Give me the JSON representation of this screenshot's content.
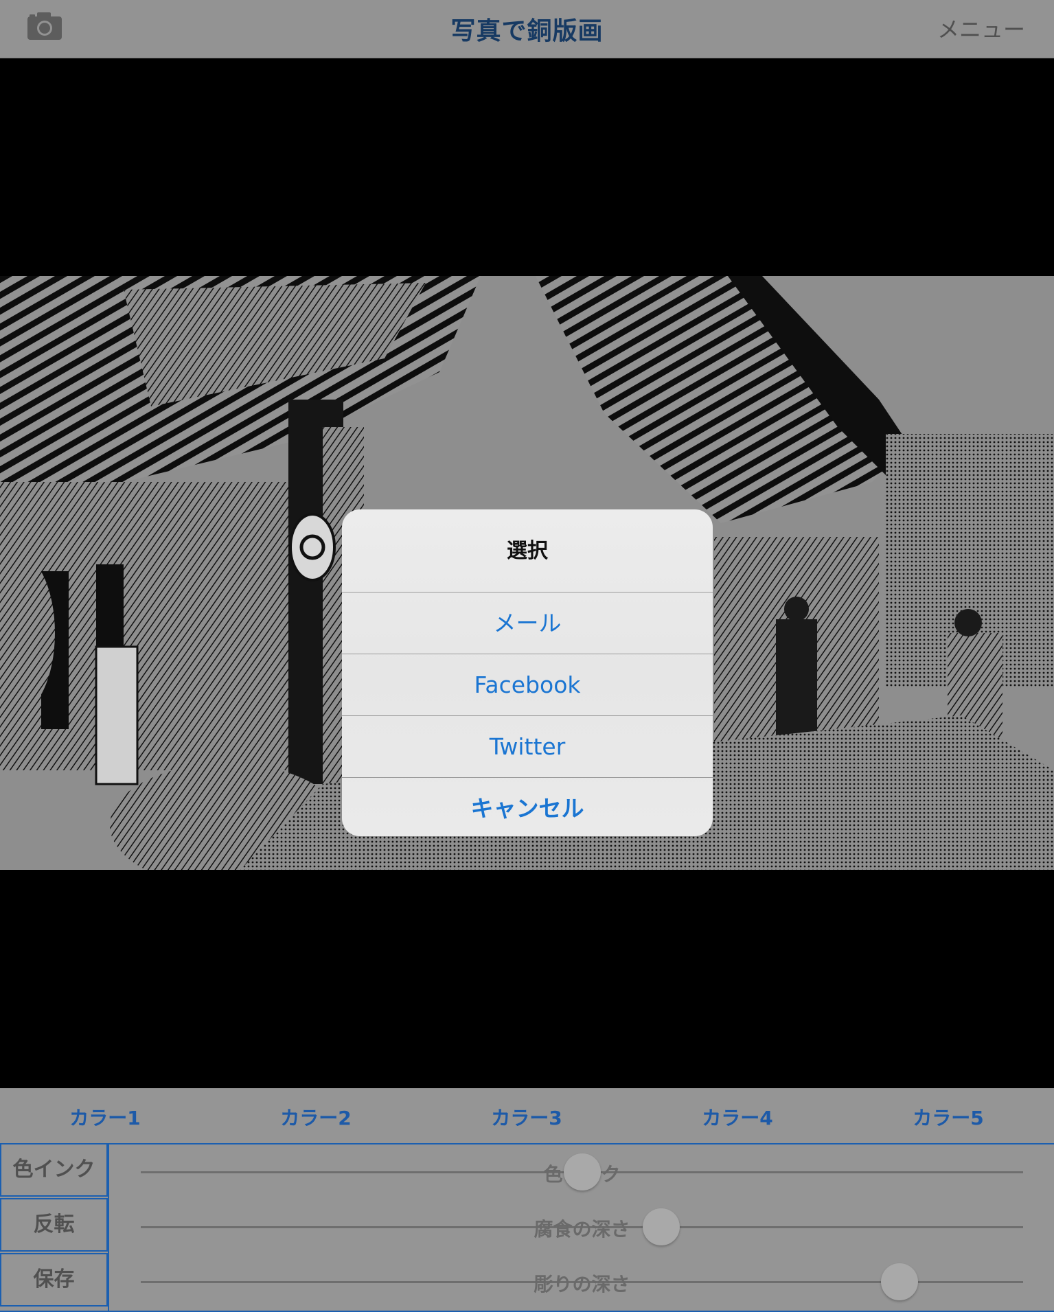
{
  "app": {
    "title": "写真で銅版画",
    "menu_label": "メニュー",
    "camera_icon": "camera-icon"
  },
  "dialog": {
    "title": "選択",
    "options": [
      "メール",
      "Facebook",
      "Twitter"
    ],
    "cancel_label": "キャンセル"
  },
  "panel": {
    "color_tabs": [
      "カラー1",
      "カラー2",
      "カラー3",
      "カラー4",
      "カラー5"
    ],
    "buttons": {
      "ink": "色インク",
      "invert": "反転",
      "save": "保存"
    },
    "sliders": {
      "ink": {
        "label": "色インク",
        "value": 0.5
      },
      "corrosion": {
        "label": "腐食の深さ",
        "value": 0.59
      },
      "carve": {
        "label": "彫りの深さ",
        "value": 0.86
      }
    }
  },
  "colors": {
    "accent": "#1a75d2",
    "title_color": "#173a63",
    "border_blue": "#1b5fb0"
  }
}
